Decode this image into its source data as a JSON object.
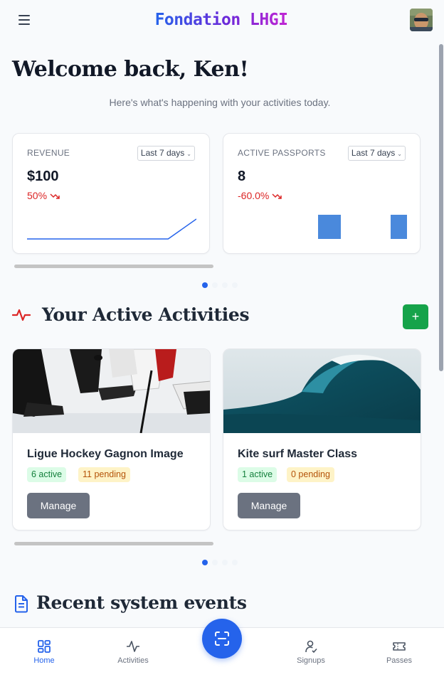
{
  "header": {
    "brand": "Fondation LHGI",
    "menu_icon": "hamburger-menu-icon",
    "avatar_alt": "user-avatar"
  },
  "welcome": {
    "title": "Welcome back, Ken!",
    "subtitle": "Here's what's happening with your activities today."
  },
  "stats": [
    {
      "label": "REVENUE",
      "period": "Last 7 days",
      "value": "$100",
      "change": "50%",
      "trend": "down",
      "chart": {
        "type": "line",
        "values": [
          0,
          0,
          0,
          0,
          0,
          0,
          100
        ]
      }
    },
    {
      "label": "ACTIVE PASSPORTS",
      "period": "Last 7 days",
      "value": "8",
      "change": "-60.0%",
      "trend": "down",
      "chart": {
        "type": "bar",
        "values": [
          0,
          0,
          0,
          1,
          0,
          0,
          1
        ]
      }
    }
  ],
  "carousel_stats": {
    "pages": 4,
    "active": 0
  },
  "activities_section": {
    "title": "Your Active Activities",
    "add_label": "+"
  },
  "activities": [
    {
      "title": "Ligue Hockey Gagnon Image",
      "active": "6 active",
      "pending": "11 pending",
      "manage": "Manage",
      "image": "hockey-image"
    },
    {
      "title": "Kite surf Master Class",
      "active": "1 active",
      "pending": "0 pending",
      "manage": "Manage",
      "image": "wave-image"
    }
  ],
  "carousel_activities": {
    "pages": 4,
    "active": 0
  },
  "events_section": {
    "title": "Recent system events"
  },
  "nav": {
    "items": [
      {
        "label": "Home",
        "icon": "dashboard-grid-icon",
        "active": true
      },
      {
        "label": "Activities",
        "icon": "activity-pulse-icon",
        "active": false
      },
      {
        "label": "Signups",
        "icon": "user-check-icon",
        "active": false
      },
      {
        "label": "Passes",
        "icon": "ticket-icon",
        "active": false
      }
    ],
    "scan_icon": "qr-scan-icon"
  },
  "colors": {
    "primary": "#2563eb",
    "success": "#16a34a",
    "danger": "#dc2626",
    "pulse": "#dc2626"
  }
}
